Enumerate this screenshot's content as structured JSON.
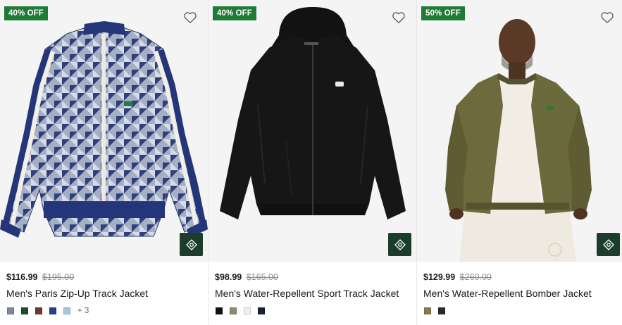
{
  "products": [
    {
      "discount": "40% OFF",
      "price": "$116.99",
      "original_price": "$195.00",
      "name": "Men's Paris Zip-Up Track Jacket",
      "swatches": [
        "#7d86a3",
        "#1f4d2c",
        "#6b3a2a",
        "#2b3f86",
        "#a9c4e4"
      ],
      "more_colors": "+ 3",
      "image": "blue-monogram-track-jacket"
    },
    {
      "discount": "40% OFF",
      "price": "$98.99",
      "original_price": "$165.00",
      "name": "Men's Water-Repellent Sport Track Jacket",
      "swatches": [
        "#111111",
        "#8f8a6e",
        "#efefef",
        "#1b2233"
      ],
      "more_colors": "",
      "image": "black-hooded-track-jacket"
    },
    {
      "discount": "50% OFF",
      "price": "$129.99",
      "original_price": "$260.00",
      "name": "Men's Water-Repellent Bomber Jacket",
      "swatches": [
        "#857a52",
        "#2a2a2a"
      ],
      "more_colors": "",
      "image": "olive-bomber-jacket-on-model"
    }
  ],
  "icons": {
    "wishlist": "heart-outline-icon",
    "quick_view": "eye-diamond-icon"
  },
  "colors": {
    "badge": "#1e7a34",
    "quick_view_bg": "#1c3d2b"
  }
}
